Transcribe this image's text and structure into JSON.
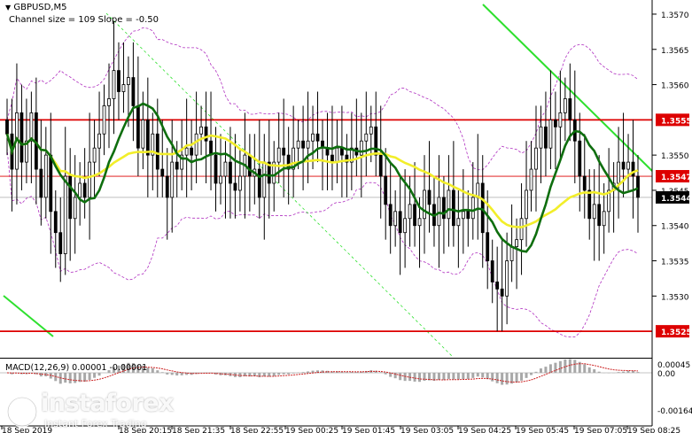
{
  "header": {
    "symbol": "GBPUSD,M5",
    "channel_info": "Channel size = 109 Slope = -0.50"
  },
  "macd": {
    "label": "MACD(12,26,9) 0.00001 -0.00001",
    "axis_ticks": [
      "0.00045",
      "0.00",
      "-0.00164"
    ]
  },
  "watermark": {
    "brand": "instaforex",
    "tagline": "Instant Forex Trading"
  },
  "colors": {
    "up_candle": "#000000",
    "down_candle": "#000000",
    "ma_fast": "#0e6e0e",
    "ma_slow": "#f2ee2a",
    "envelope": "#b030c0",
    "channel": "#2ee02e",
    "level_line": "#dd0000",
    "price_line": "#d02020"
  },
  "chart_data": {
    "type": "candlestick",
    "ylim": [
      1.3522,
      1.3571
    ],
    "y_ticks": [
      1.357,
      1.3565,
      1.356,
      1.355,
      1.3545,
      1.354,
      1.3535,
      1.353
    ],
    "y_tick_labels": [
      "1.3570",
      "1.3565",
      "1.3560",
      "1.3550",
      "1.3545",
      "1.3540",
      "1.3535",
      "1.3530"
    ],
    "x_labels": [
      "18 Sep 2019",
      "18 Sep 20:15",
      "18 Sep 21:35",
      "18 Sep 22:55",
      "19 Sep 00:25",
      "19 Sep 01:45",
      "19 Sep 03:05",
      "19 Sep 04:25",
      "19 Sep 05:45",
      "19 Sep 07:05",
      "19 Sep 08:25"
    ],
    "levels": [
      {
        "label": "1.3555",
        "value": 1.3555
      },
      {
        "label": "1.3547",
        "value": 1.3547
      },
      {
        "label": "1.3525",
        "value": 1.3525
      }
    ],
    "current_price": {
      "label": "1.3544",
      "value": 1.3544
    },
    "closes": [
      1.3553,
      1.3548,
      1.3556,
      1.3549,
      1.3552,
      1.3556,
      1.3548,
      1.3544,
      1.355,
      1.3542,
      1.3539,
      1.3536,
      1.3547,
      1.3541,
      1.3544,
      1.3546,
      1.3544,
      1.3549,
      1.3551,
      1.3553,
      1.3557,
      1.3558,
      1.3562,
      1.3559,
      1.356,
      1.3561,
      1.3557,
      1.3551,
      1.3555,
      1.355,
      1.3553,
      1.3548,
      1.3547,
      1.3544,
      1.3549,
      1.3548,
      1.355,
      1.3551,
      1.355,
      1.3553,
      1.3554,
      1.3552,
      1.355,
      1.3546,
      1.3547,
      1.3549,
      1.3546,
      1.3545,
      1.3547,
      1.355,
      1.3547,
      1.3548,
      1.3544,
      1.3549,
      1.3546,
      1.3549,
      1.3551,
      1.355,
      1.3548,
      1.3551,
      1.3552,
      1.3551,
      1.3552,
      1.3553,
      1.3552,
      1.3551,
      1.355,
      1.3549,
      1.3551,
      1.355,
      1.3549,
      1.3551,
      1.355,
      1.3552,
      1.3553,
      1.3554,
      1.355,
      1.3547,
      1.3543,
      1.354,
      1.3542,
      1.3539,
      1.3541,
      1.3543,
      1.354,
      1.3541,
      1.3545,
      1.3543,
      1.354,
      1.3544,
      1.3541,
      1.3545,
      1.354,
      1.3541,
      1.3542,
      1.3541,
      1.3544,
      1.3546,
      1.3539,
      1.3535,
      1.3532,
      1.3531,
      1.353,
      1.3535,
      1.3537,
      1.3538,
      1.3541,
      1.3545,
      1.3548,
      1.3551,
      1.3554,
      1.3551,
      1.3555,
      1.3554,
      1.3556,
      1.3558,
      1.3555,
      1.3552,
      1.3547,
      1.3545,
      1.3541,
      1.3543,
      1.354,
      1.3542,
      1.3545,
      1.3546,
      1.3549,
      1.3548,
      1.3549,
      1.3547,
      1.3544
    ]
  }
}
